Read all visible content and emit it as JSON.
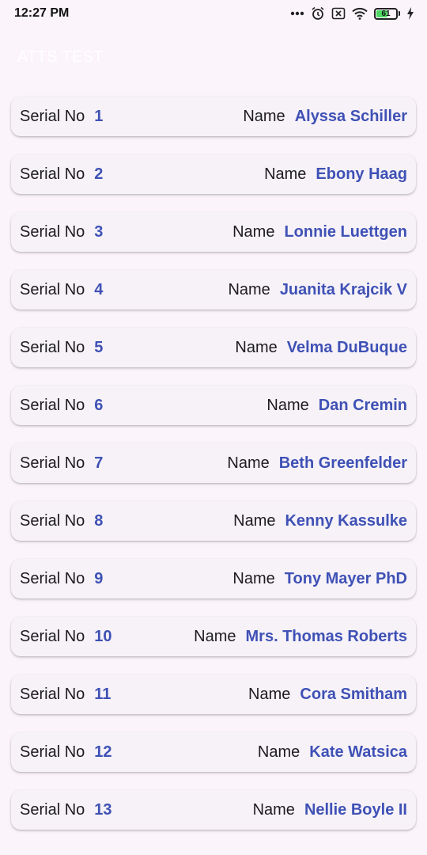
{
  "status_bar": {
    "time": "12:27 PM",
    "battery_percent": 61,
    "icons": [
      "more-dots-icon",
      "alarm-icon",
      "notification-off-icon",
      "wifi-icon",
      "battery-icon",
      "charging-bolt-icon"
    ]
  },
  "app_bar": {
    "title": "ATTS TEST"
  },
  "labels": {
    "serial": "Serial No",
    "name": "Name"
  },
  "colors": {
    "accent": "#3f51b5",
    "background": "#fbf4fb",
    "card": "#f6f2f8"
  },
  "rows": [
    {
      "serial": "1",
      "name": "Alyssa Schiller"
    },
    {
      "serial": "2",
      "name": "Ebony Haag"
    },
    {
      "serial": "3",
      "name": "Lonnie Luettgen"
    },
    {
      "serial": "4",
      "name": "Juanita Krajcik V"
    },
    {
      "serial": "5",
      "name": "Velma DuBuque"
    },
    {
      "serial": "6",
      "name": "Dan Cremin"
    },
    {
      "serial": "7",
      "name": "Beth Greenfelder"
    },
    {
      "serial": "8",
      "name": "Kenny Kassulke"
    },
    {
      "serial": "9",
      "name": "Tony Mayer PhD"
    },
    {
      "serial": "10",
      "name": "Mrs. Thomas Roberts"
    },
    {
      "serial": "11",
      "name": "Cora Smitham"
    },
    {
      "serial": "12",
      "name": "Kate Watsica"
    },
    {
      "serial": "13",
      "name": "Nellie Boyle II"
    }
  ]
}
